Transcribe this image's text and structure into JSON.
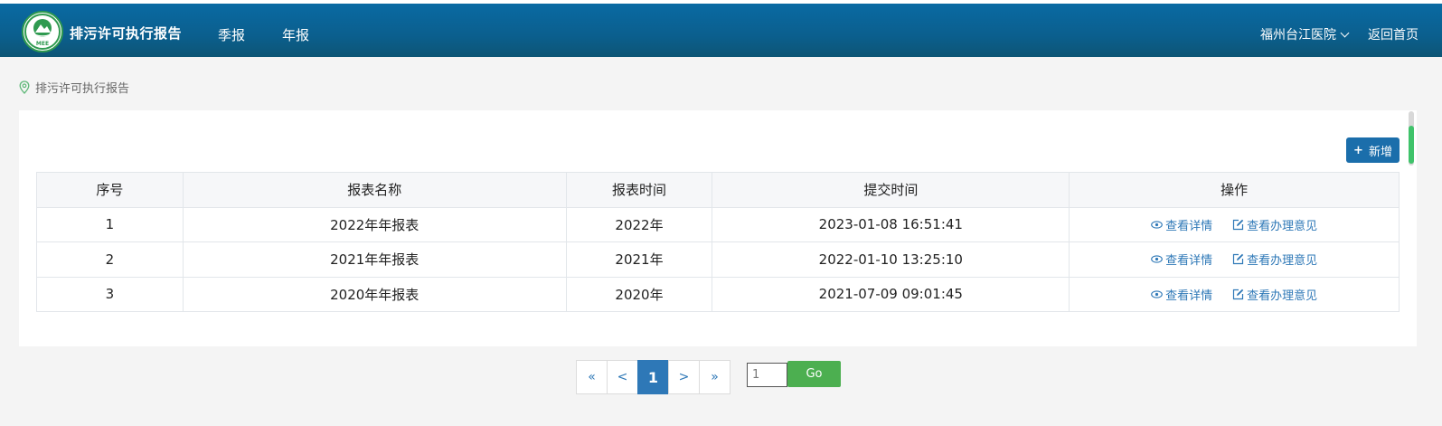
{
  "header": {
    "app_title": "排污许可执行报告",
    "nav": [
      "季报",
      "年报"
    ],
    "org_name": "福州台江医院",
    "home_link": "返回首页",
    "logo_text": "MEE"
  },
  "breadcrumb": {
    "label": "排污许可执行报告"
  },
  "toolbar": {
    "add_label": "新增",
    "add_icon": "+"
  },
  "table": {
    "columns": [
      "序号",
      "报表名称",
      "报表时间",
      "提交时间",
      "操作"
    ],
    "rows": [
      {
        "index": "1",
        "name": "2022年年报表",
        "period": "2022年",
        "submitted": "2023-01-08 16:51:41",
        "view": "查看详情",
        "opinion": "查看办理意见"
      },
      {
        "index": "2",
        "name": "2021年年报表",
        "period": "2021年",
        "submitted": "2022-01-10 13:25:10",
        "view": "查看详情",
        "opinion": "查看办理意见"
      },
      {
        "index": "3",
        "name": "2020年年报表",
        "period": "2020年",
        "submitted": "2021-07-09 09:01:45",
        "view": "查看详情",
        "opinion": "查看办理意见"
      }
    ]
  },
  "pagination": {
    "first": "«",
    "prev": "<",
    "current": "1",
    "next": ">",
    "last": "»",
    "input_value": "1",
    "go_label": "Go"
  },
  "colors": {
    "header": "#0b5f8e",
    "primary": "#1b6eab",
    "link": "#2e78b7",
    "go": "#4caf50"
  }
}
